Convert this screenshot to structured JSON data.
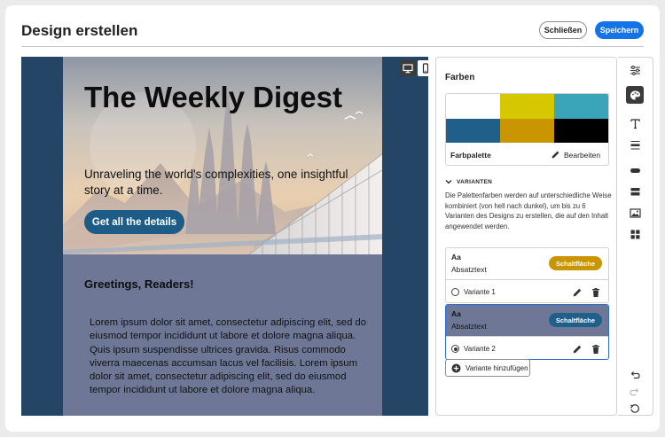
{
  "header": {
    "title": "Design erstellen",
    "close_label": "Schließen",
    "save_label": "Speichern"
  },
  "preview": {
    "hero_title": "The Weekly Digest",
    "hero_subtitle": "Unraveling the world's complexities, one insightful story at a time.",
    "cta_label": "Get all the details",
    "greeting": "Greetings, Readers!",
    "body_text": "Lorem ipsum dolor sit amet, consectetur adipiscing elit, sed do eiusmod tempor incididunt ut labore et dolore magna aliqua. Quis ipsum suspendisse ultrices gravida. Risus commodo viverra maecenas accumsan lacus vel facilisis. Lorem ipsum dolor sit amet, consectetur adipiscing elit, sed do eiusmod tempor incididunt ut labore et dolore magna aliqua.",
    "device_modes": [
      "desktop",
      "mobile"
    ],
    "active_device": "mobile"
  },
  "panel": {
    "title": "Farben",
    "palette": {
      "label": "Farbpalette",
      "edit_label": "Bearbeiten",
      "colors": [
        "#ffffff",
        "#d6c800",
        "#3aa5b8",
        "#1f5f8a",
        "#c99500",
        "#000000"
      ]
    },
    "variants": {
      "heading": "VARIANTEN",
      "description": "Die Palettenfarben werden auf unterschiedliche Weise kombiniert (von hell nach dunkel), um bis zu 6 Varianten des Designs zu erstellen, die auf den Inhalt angewendet werden.",
      "items": [
        {
          "aa": "Aa",
          "body": "Absatztext",
          "button": "Schaltfläche",
          "name": "Variante 1",
          "selected": false,
          "bg": "#ffffff",
          "text_color": "#222222",
          "button_color": "#c99500"
        },
        {
          "aa": "Aa",
          "body": "Absatztext",
          "button": "Schaltfläche",
          "name": "Variante 2",
          "selected": true,
          "bg": "#6e7896",
          "text_color": "#111111",
          "button_color": "#1f5f8a"
        }
      ],
      "add_label": "Variante hinzufügen"
    }
  },
  "toolbar": {
    "tools": [
      "settings-sliders-icon",
      "color-palette-icon",
      "text-icon",
      "divider-icon",
      "button-icon",
      "structure-icon",
      "image-icon",
      "components-icon"
    ],
    "active_tool": "color-palette-icon",
    "bottom_tools": [
      "undo-icon",
      "redo-icon",
      "reset-icon"
    ]
  }
}
